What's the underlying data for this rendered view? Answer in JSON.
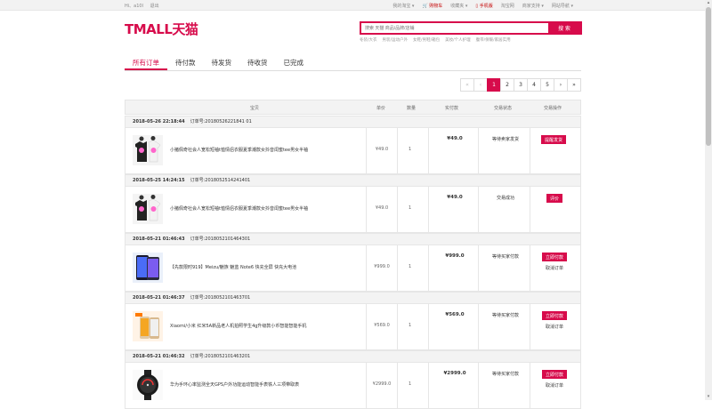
{
  "topbar": {
    "greeting": "Hi、a10l",
    "logout": "退出",
    "links": [
      "我的淘宝 ▾",
      "购物车",
      "收藏夹 ▾",
      "手机版",
      "淘宝网",
      "商家支持 ▾",
      "网站导航 ▾"
    ]
  },
  "logo": "TMALL天猫",
  "search": {
    "placeholder": "搜索 天猫 商品/品牌/店铺",
    "button": "搜 索",
    "hotwords": [
      "冬装/大衣",
      "男装/运动户外",
      "女鞋/男鞋/箱包",
      "美妆/个人护理",
      "腹带/保暖/家居实用"
    ]
  },
  "tabs": [
    "所有订单",
    "待付款",
    "待发货",
    "待收货",
    "已完成"
  ],
  "pager": [
    "«",
    "‹",
    "1",
    "2",
    "3",
    "4",
    "5",
    "›",
    "»"
  ],
  "table_header": {
    "product": "宝贝",
    "unit_price": "单价",
    "quantity": "数量",
    "paid": "实付款",
    "status": "交易状态",
    "action": "交易操作"
  },
  "orders": [
    {
      "date": "2018-05-26 22:18:44",
      "order_no": "订单号:20180526221841 01",
      "title": "小猪佩奇社会人宽松短袖t恤情侣衣服夏季潮款女抖音闺蜜tee男女半袖",
      "price": "¥49.0",
      "qty": "1",
      "paid": "¥49.0",
      "status": "等待卖家发货",
      "button": "提醒发货",
      "cancel": ""
    },
    {
      "date": "2018-05-25 14:24:15",
      "order_no": "订单号:2018052514241401",
      "title": "小猪佩奇社会人宽松短袖t恤情侣衣服夏季潮款女抖音闺蜜tee男女半袖",
      "price": "¥49.0",
      "qty": "1",
      "paid": "¥49.0",
      "status": "交易成功",
      "button": "评价",
      "cancel": ""
    },
    {
      "date": "2018-05-21 01:46:43",
      "order_no": "订单号:2018052101464301",
      "title": "【先款限时919】Meizu/魅族 魅蓝 Note6 快充全屏 快充大电池",
      "price": "¥999.0",
      "qty": "1",
      "paid": "¥999.0",
      "status": "等待买家付款",
      "button": "立即付款",
      "cancel": "取消订单"
    },
    {
      "date": "2018-05-21 01:46:37",
      "order_no": "订单号:2018052101463701",
      "title": "Xiaomi/小米 红米5A新品老人机拍照学生4g升级款小币智能智能手机",
      "price": "¥569.0",
      "qty": "1",
      "paid": "¥569.0",
      "status": "等待买家付款",
      "button": "立即付款",
      "cancel": "取消订单"
    },
    {
      "date": "2018-05-21 01:46:32",
      "order_no": "订单号:2018052101463201",
      "title": "华为手环心率监测全天GPS户外功能运动智能手表铁人三项带取表",
      "price": "¥2999.0",
      "qty": "1",
      "paid": "¥2999.0",
      "status": "等待买家付款",
      "button": "立即付款",
      "cancel": "取消订单"
    }
  ],
  "colors": {
    "accent": "#d70b4b"
  }
}
